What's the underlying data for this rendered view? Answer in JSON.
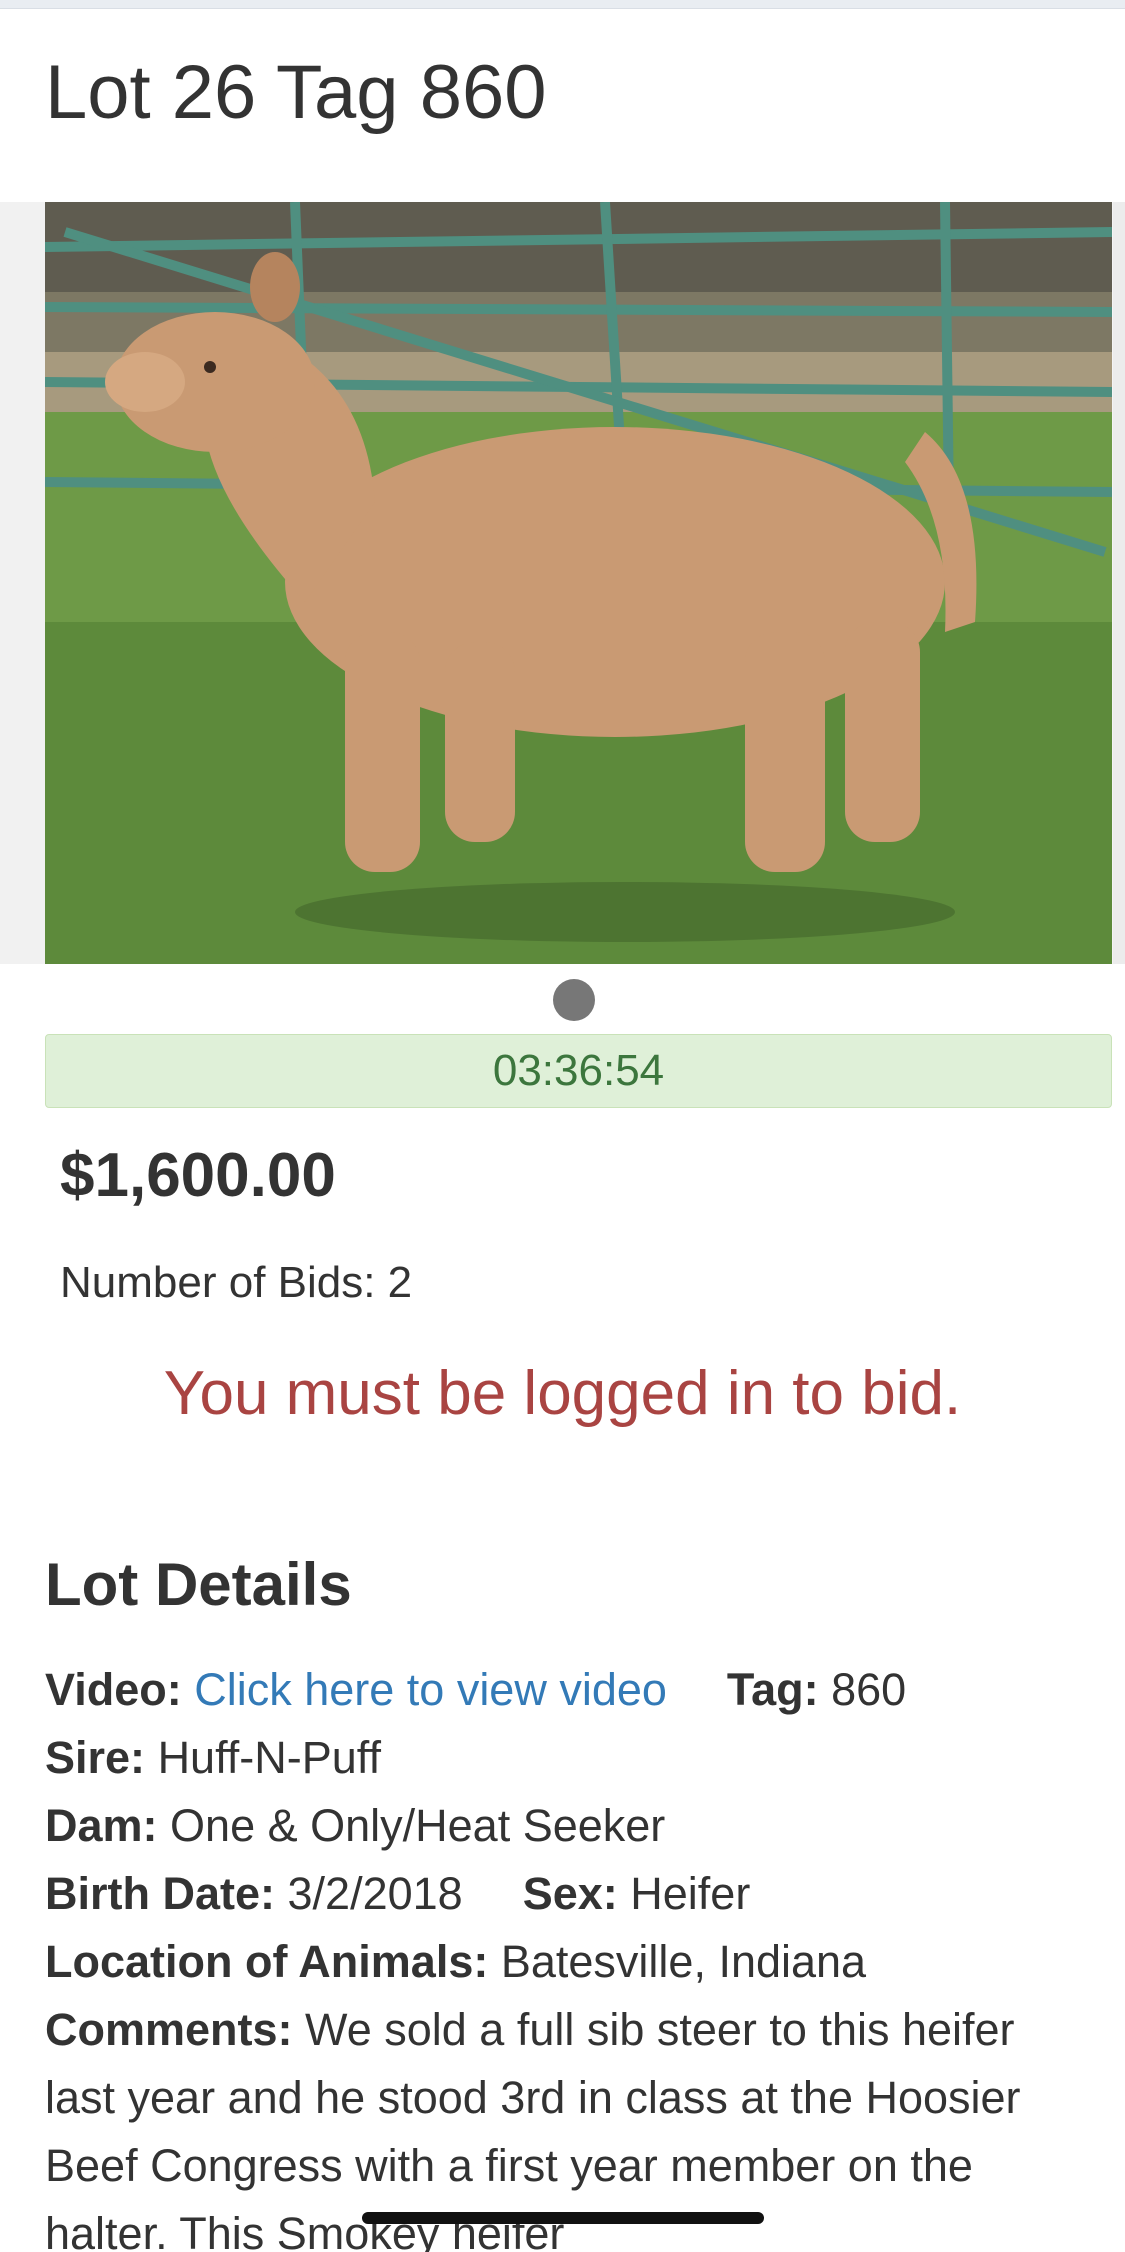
{
  "lot": {
    "title": "Lot 26 Tag 860"
  },
  "gallery": {
    "dot_count": 1,
    "active_index": 0,
    "image_alt": "Heifer photo"
  },
  "auction": {
    "timer": "03:36:54",
    "price": "$1,600.00",
    "bids_text": "Number of Bids: 2",
    "login_message": "You must be logged in to bid."
  },
  "details": {
    "heading": "Lot Details",
    "video_label": "Video:",
    "video_link": "Click here to view video",
    "tag_label": "Tag:",
    "tag_value": "860",
    "sire_label": "Sire:",
    "sire_value": "Huff-N-Puff",
    "dam_label": "Dam:",
    "dam_value": "One & Only/Heat Seeker",
    "birth_label": "Birth Date:",
    "birth_value": "3/2/2018",
    "sex_label": "Sex:",
    "sex_value": "Heifer",
    "location_label": "Location of Animals:",
    "location_value": "Batesville, Indiana",
    "comments_label": "Comments:",
    "comments_value": "We sold a full sib steer to this heifer last year and he stood 3rd in class at the Hoosier Beef Congress with a first year member on the halter. This Smokey heifer"
  },
  "colors": {
    "timer_bg": "#dff0d8",
    "timer_text": "#3c763d",
    "alert_text": "#a94442",
    "link": "#337ab7"
  }
}
